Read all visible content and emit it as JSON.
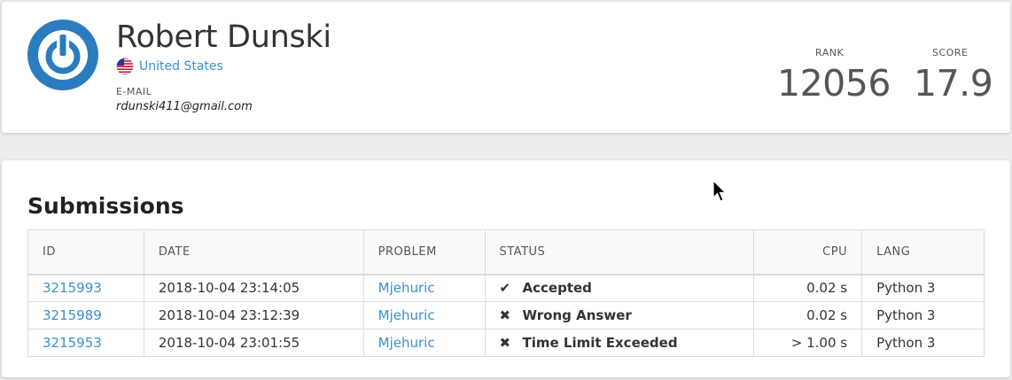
{
  "profile": {
    "name": "Robert Dunski",
    "country": "United States",
    "email_label": "E-MAIL",
    "email": "rdunski411@gmail.com",
    "rank_label": "RANK",
    "rank": "12056",
    "score_label": "SCORE",
    "score": "17.9",
    "avatar_icon": "power-logo-icon",
    "flag_icon": "us-flag-icon",
    "accent_color": "#2b7bbf"
  },
  "submissions": {
    "title": "Submissions",
    "columns": {
      "id": "ID",
      "date": "DATE",
      "problem": "PROBLEM",
      "status": "STATUS",
      "cpu": "CPU",
      "lang": "LANG"
    },
    "rows": [
      {
        "id": "3215993",
        "date": "2018-10-04 23:14:05",
        "problem": "Mjehuric",
        "status": "Accepted",
        "status_icon": "check-icon",
        "status_color": "#2eaa3c",
        "cpu": "0.02 s",
        "lang": "Python 3"
      },
      {
        "id": "3215989",
        "date": "2018-10-04 23:12:39",
        "problem": "Mjehuric",
        "status": "Wrong Answer",
        "status_icon": "x-icon",
        "status_color": "#d92020",
        "cpu": "0.02 s",
        "lang": "Python 3"
      },
      {
        "id": "3215953",
        "date": "2018-10-04 23:01:55",
        "problem": "Mjehuric",
        "status": "Time Limit Exceeded",
        "status_icon": "x-icon",
        "status_color": "#d92020",
        "cpu": "> 1.00 s",
        "lang": "Python 3"
      }
    ]
  }
}
